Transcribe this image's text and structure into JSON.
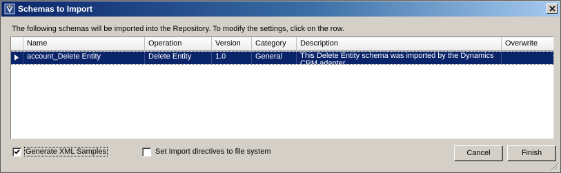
{
  "window": {
    "title": "Schemas to Import",
    "title_icon": "schema-import-icon",
    "close_icon": "close-icon"
  },
  "intro_text": "The following schemas will be imported into the Repository.  To modify the settings, click on the row.",
  "table": {
    "columns": [
      "Name",
      "Operation",
      "Version",
      "Category",
      "Description",
      "Overwrite"
    ],
    "rows": [
      {
        "name": "account_Delete Entity",
        "operation": "Delete Entity",
        "version": "1.0",
        "category": "General",
        "description": "This Delete Entity schema was imported by the Dynamics CRM adapter.",
        "overwrite": false,
        "selected": true
      }
    ]
  },
  "options": {
    "generate_xml_samples": {
      "label": "Generate XML Samples",
      "checked": true
    },
    "set_import_directives": {
      "label": "Set Import directives to file system",
      "checked": false
    }
  },
  "buttons": {
    "cancel": "Cancel",
    "finish": "Finish"
  },
  "colors": {
    "title_bar_start": "#0a246a",
    "title_bar_end": "#a6caf0",
    "selection": "#0a246a",
    "dialog_background": "#d4d0c8"
  }
}
